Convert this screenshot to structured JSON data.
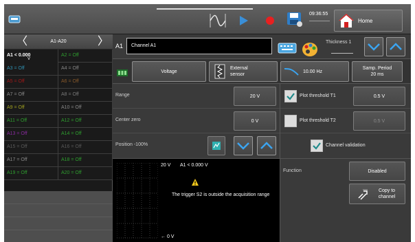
{
  "topbar": {
    "clock": "09:36:55",
    "home_label": "Home"
  },
  "left_panel": {
    "title": "A1-A20",
    "prev": "〈",
    "next": "〉",
    "rows": [
      [
        {
          "label": "A1 < 0.000",
          "sub": "V",
          "color": "#ffffff"
        },
        {
          "label": "A2 = Off",
          "color": "#2f9e2f"
        }
      ],
      [
        {
          "label": "A3 = Off",
          "color": "#2f8fb0"
        },
        {
          "label": "A4 = Off",
          "color": "#888888"
        }
      ],
      [
        {
          "label": "A5 = Off",
          "color": "#a01818"
        },
        {
          "label": "A6 = Off",
          "color": "#8a5a2a"
        }
      ],
      [
        {
          "label": "A7 = Off",
          "color": "#8a8a8a"
        },
        {
          "label": "A8 = Off",
          "color": "#7a7a7a"
        }
      ],
      [
        {
          "label": "A9 = Off",
          "color": "#a0a020"
        },
        {
          "label": "A10 = Off",
          "color": "#8a8a8a"
        }
      ],
      [
        {
          "label": "A11 = Off",
          "color": "#2fa02f"
        },
        {
          "label": "A12 = Off",
          "color": "#2fa02f"
        }
      ],
      [
        {
          "label": "A13 = Off",
          "color": "#8a2aa0"
        },
        {
          "label": "A14 = Off",
          "color": "#2fa02f"
        }
      ],
      [
        {
          "label": "A15 = Off",
          "color": "#5a5a5a"
        },
        {
          "label": "A16 = Off",
          "color": "#5a5a5a"
        }
      ],
      [
        {
          "label": "A17 = Off",
          "color": "#8a8a8a"
        },
        {
          "label": "A18 = Off",
          "color": "#2fa02f"
        }
      ],
      [
        {
          "label": "A19 = Off",
          "color": "#2f9e2f"
        },
        {
          "label": "A20 = Off",
          "color": "#2f9e2f"
        }
      ]
    ]
  },
  "channel_bar": {
    "id": "A1",
    "name": "Channel A1",
    "thickness_label": "Thickness 1"
  },
  "sensor_row": {
    "voltage_label": "Voltage",
    "sensor_label_1": "External",
    "sensor_label_2": "sensor",
    "filter_label": "10.00 Hz",
    "samp_label_1": "Samp. Period",
    "samp_label_2": "20 ms"
  },
  "settings": {
    "range_label": "Range",
    "range_value": "20 V",
    "center_label": "Center zero",
    "center_value": "0 V",
    "position_label": "Position -100%"
  },
  "threshold": {
    "t1_label": "Plot threshold T1",
    "t1_value": "0.5 V",
    "t1_checked": true,
    "t2_label": "Plot threshold T2",
    "t2_value": "0.5 V",
    "t2_checked": false,
    "validation_label": "Channel validation",
    "validation_checked": true
  },
  "graph": {
    "top_label": "20 V",
    "bottom_label": "← 0 V",
    "channel_reading": "A1 < 0.000 V",
    "message": "The trigger S2 is outside the acquisition range"
  },
  "function": {
    "label": "Function",
    "value": "Disabled",
    "copy_label_1": "Copy to",
    "copy_label_2": "channel"
  }
}
